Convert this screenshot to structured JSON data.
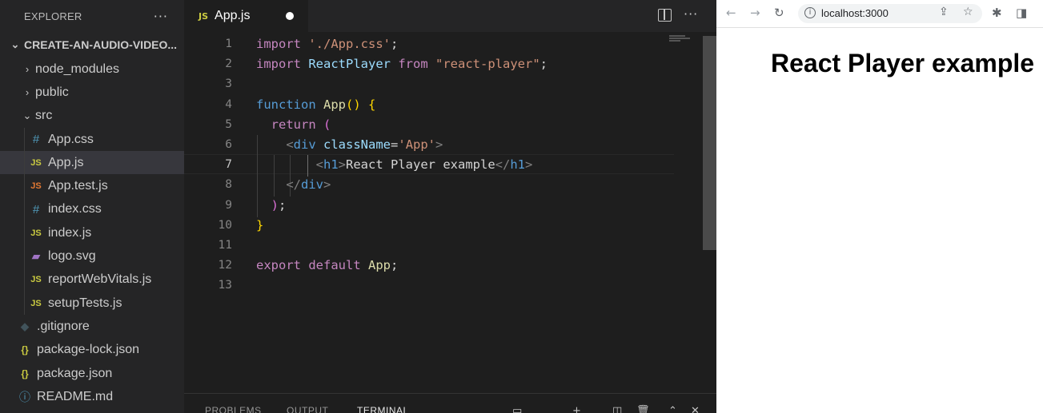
{
  "sidebar": {
    "title": "EXPLORER",
    "more_icon": "ellipsis-icon",
    "project": "CREATE-AN-AUDIO-VIDEO...",
    "items": [
      {
        "label": "node_modules",
        "kind": "folder",
        "expanded": false
      },
      {
        "label": "public",
        "kind": "folder",
        "expanded": false
      },
      {
        "label": "src",
        "kind": "folder",
        "expanded": true
      },
      {
        "label": "App.css",
        "kind": "css"
      },
      {
        "label": "App.js",
        "kind": "js",
        "active": true
      },
      {
        "label": "App.test.js",
        "kind": "jstest"
      },
      {
        "label": "index.css",
        "kind": "css"
      },
      {
        "label": "index.js",
        "kind": "js"
      },
      {
        "label": "logo.svg",
        "kind": "svg"
      },
      {
        "label": "reportWebVitals.js",
        "kind": "js"
      },
      {
        "label": "setupTests.js",
        "kind": "js"
      },
      {
        "label": ".gitignore",
        "kind": "git"
      },
      {
        "label": "package-lock.json",
        "kind": "json"
      },
      {
        "label": "package.json",
        "kind": "json"
      },
      {
        "label": "README.md",
        "kind": "info"
      }
    ]
  },
  "editor": {
    "tab": {
      "label": "App.js",
      "icon_text": "JS",
      "dirty": true
    },
    "current_line": 7,
    "line_numbers": [
      "1",
      "2",
      "3",
      "4",
      "5",
      "6",
      "7",
      "8",
      "9",
      "10",
      "11",
      "12",
      "13"
    ],
    "code": {
      "l1": {
        "kw": "import",
        "s": "'./App.css'",
        "end": ";"
      },
      "l2": {
        "kw": "import",
        "id": "ReactPlayer",
        "from": "from",
        "s": "\"react-player\"",
        "end": ";"
      },
      "l4": {
        "kw": "function",
        "fn": "App",
        "open": "()",
        "brace": "{"
      },
      "l5": {
        "kw": "return",
        "paren": "("
      },
      "l6": {
        "lt": "<",
        "tag": "div",
        "attr": "className",
        "eq": "=",
        "s": "'App'",
        "gt": ">"
      },
      "l7": {
        "lt": "<",
        "tag": "h1",
        "gt": ">",
        "text": "React Player example",
        "close_lt": "</",
        "close_tag": "h1",
        "close_gt": ">"
      },
      "l8": {
        "lt": "</",
        "tag": "div",
        "gt": ">"
      },
      "l9": {
        "paren": ")",
        "end": ";"
      },
      "l10": {
        "brace": "}"
      },
      "l12": {
        "kw1": "export",
        "kw2": "default",
        "id": "App",
        "end": ";"
      }
    },
    "panel_tabs": [
      "PROBLEMS",
      "OUTPUT",
      "TERMINAL"
    ]
  },
  "browser": {
    "url": "localhost:3000",
    "heading": "React Player example"
  },
  "colors": {
    "sidebar_bg": "#252526",
    "editor_bg": "#1e1e1e",
    "keyword": "#c586c0",
    "string": "#ce9178",
    "tag": "#569cd6",
    "js_icon": "#cbcb41"
  }
}
